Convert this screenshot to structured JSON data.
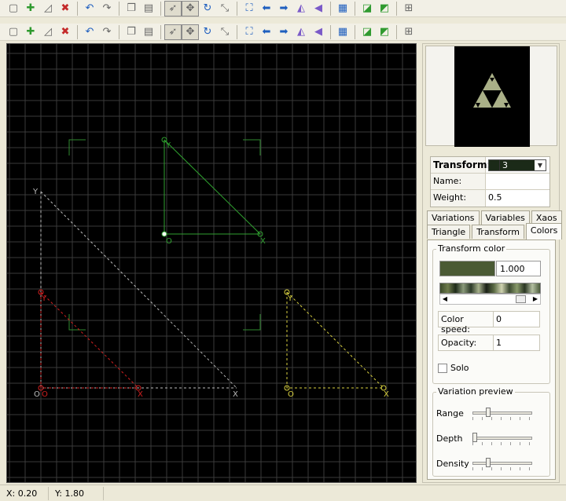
{
  "toolbar": {
    "buttons": [
      {
        "name": "new-icon",
        "glyph": "▢"
      },
      {
        "name": "add-transform-icon",
        "glyph": "✚"
      },
      {
        "name": "duplicate-icon",
        "glyph": "◿"
      },
      {
        "name": "delete-transform-icon",
        "glyph": "✖"
      },
      {
        "name": "undo-icon",
        "glyph": "↶"
      },
      {
        "name": "redo-icon",
        "glyph": "↷"
      },
      {
        "name": "copy-icon",
        "glyph": "❐"
      },
      {
        "name": "paste-icon",
        "glyph": "▤"
      },
      {
        "name": "select-mode-icon",
        "glyph": "➶"
      },
      {
        "name": "move-mode-icon",
        "glyph": "✥"
      },
      {
        "name": "rotate-mode-icon",
        "glyph": "↻"
      },
      {
        "name": "scale-mode-icon",
        "glyph": "⤡"
      },
      {
        "name": "fit-view-icon",
        "glyph": "⛶"
      },
      {
        "name": "rotate-left-icon",
        "glyph": "⬅"
      },
      {
        "name": "rotate-right-icon",
        "glyph": "➡"
      },
      {
        "name": "flip-horizontal-icon",
        "glyph": "◭"
      },
      {
        "name": "flip-vertical-icon",
        "glyph": "◀"
      },
      {
        "name": "grid-icon",
        "glyph": "▦"
      },
      {
        "name": "post-transform-icon",
        "glyph": "◪"
      },
      {
        "name": "post-transform-reset-icon",
        "glyph": "◩"
      },
      {
        "name": "axis-lock-icon",
        "glyph": "⊞"
      }
    ]
  },
  "canvas": {
    "label_y": "Y",
    "label_x": "X",
    "label_o": "O",
    "colors": {
      "green": "#2fa02f",
      "red": "#d02020",
      "yellow": "#d8d040",
      "gray": "#bbbbbb",
      "grid": "#3a3a3a",
      "bracket": "#2f8a2f"
    }
  },
  "sidebar": {
    "transform_label": "Transform:",
    "transform_value": "3",
    "name_label": "Name:",
    "name_value": "",
    "weight_label": "Weight:",
    "weight_value": "0.5",
    "tabs_row1": [
      "Variations",
      "Variables",
      "Xaos"
    ],
    "tabs_row2": [
      "Triangle",
      "Transform",
      "Colors"
    ],
    "active_tab": "Colors",
    "transform_color_title": "Transform color",
    "transform_color_value": "1.000",
    "transform_color": "#4a5a34",
    "color_speed_label": "Color speed:",
    "color_speed_value": "0",
    "opacity_label": "Opacity:",
    "opacity_value": "1",
    "solo_label": "Solo",
    "variation_preview_title": "Variation preview",
    "range_label": "Range",
    "depth_label": "Depth",
    "density_label": "Density"
  },
  "status": {
    "x": "X: 0.20",
    "y": "Y: 1.80"
  }
}
